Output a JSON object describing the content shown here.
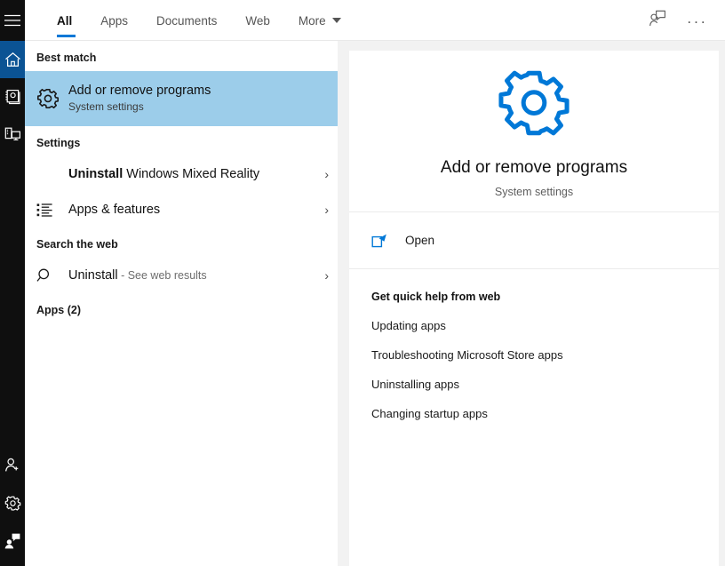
{
  "rail": {
    "items": [
      {
        "name": "hamburger-menu",
        "icon": "hamburger-icon",
        "label": "Menu"
      },
      {
        "name": "home",
        "icon": "home-icon",
        "label": "Home",
        "active": true
      },
      {
        "name": "documents",
        "icon": "notebook-icon",
        "label": "Documents"
      },
      {
        "name": "devices",
        "icon": "devices-icon",
        "label": "Devices"
      }
    ],
    "bottom_items": [
      {
        "name": "account",
        "icon": "person-add-icon",
        "label": "Account"
      },
      {
        "name": "settings",
        "icon": "gear-icon",
        "label": "Settings"
      },
      {
        "name": "feedback",
        "icon": "feedback-person-icon",
        "label": "Feedback"
      }
    ]
  },
  "tabs": [
    {
      "label": "All",
      "active": true
    },
    {
      "label": "Apps",
      "active": false
    },
    {
      "label": "Documents",
      "active": false
    },
    {
      "label": "Web",
      "active": false
    },
    {
      "label": "More",
      "active": false,
      "caret": true
    }
  ],
  "topright": {
    "feedback_label": "Feedback",
    "more_label": "..."
  },
  "results": {
    "best_match": {
      "header": "Best match",
      "title": "Add or remove programs",
      "subtitle": "System settings",
      "icon": "gear-icon"
    },
    "settings": {
      "header": "Settings",
      "items": [
        {
          "bold_prefix": "Uninstall",
          "rest": " Windows Mixed Reality",
          "icon": "",
          "chevron": "›"
        },
        {
          "bold_prefix": "",
          "rest": "Apps & features",
          "icon": "list-icon",
          "chevron": "›"
        }
      ]
    },
    "web": {
      "header": "Search the web",
      "items": [
        {
          "bold_prefix": "",
          "rest": "Uninstall",
          "dim": " - See web results",
          "icon": "search-icon",
          "chevron": "›"
        }
      ]
    },
    "apps": {
      "header": "Apps (2)"
    }
  },
  "preview": {
    "title": "Add or remove programs",
    "subtitle": "System settings",
    "hero_icon": "gear-icon",
    "open": {
      "label": "Open",
      "icon": "open-external-icon"
    },
    "help": {
      "header": "Get quick help from web",
      "links": [
        "Updating apps",
        "Troubleshooting Microsoft Store apps",
        "Uninstalling apps",
        "Changing startup apps"
      ]
    }
  },
  "colors": {
    "accent": "#0078d7",
    "rail_bg": "#0f0f0f",
    "rail_active": "#0b5394",
    "highlight": "#9ccdea",
    "preview_gutter": "#f2f2f2"
  }
}
